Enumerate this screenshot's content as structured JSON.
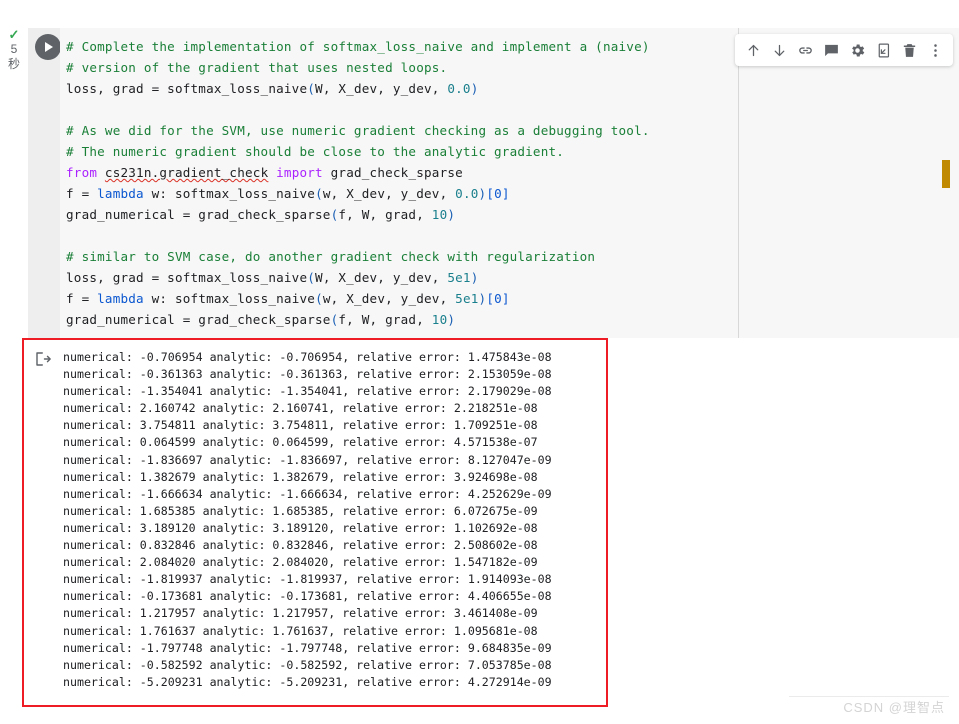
{
  "run_status": {
    "check_glyph": "✓",
    "seconds": "5",
    "unit": "秒",
    "check_color": "#34a853"
  },
  "cell": {
    "run_button_label": "run-cell",
    "toolbar": [
      {
        "name": "move-cell-up-icon",
        "label": "↑"
      },
      {
        "name": "move-cell-down-icon",
        "label": "↓"
      },
      {
        "name": "link-to-cell-icon",
        "label": "link"
      },
      {
        "name": "add-comment-icon",
        "label": "comment"
      },
      {
        "name": "cell-settings-icon",
        "label": "settings"
      },
      {
        "name": "mirror-cell-icon",
        "label": "mirror-cell"
      },
      {
        "name": "delete-cell-icon",
        "label": "delete"
      },
      {
        "name": "more-options-icon",
        "label": "⋮"
      }
    ]
  },
  "code": {
    "lines": [
      [
        {
          "t": "# Complete the implementation of softmax_loss_naive and implement a (naive)",
          "c": "tok-com"
        }
      ],
      [
        {
          "t": "# version of the gradient that uses nested loops.",
          "c": "tok-com"
        }
      ],
      [
        {
          "t": "loss, grad = softmax_loss_naive",
          "c": "tok-id"
        },
        {
          "t": "(",
          "c": "tok-par"
        },
        {
          "t": "W, X_dev, y_dev, ",
          "c": "tok-id"
        },
        {
          "t": "0.0",
          "c": "tok-num"
        },
        {
          "t": ")",
          "c": "tok-par"
        }
      ],
      [],
      [
        {
          "t": "# As we did for the SVM, use numeric gradient checking as a debugging tool.",
          "c": "tok-com"
        }
      ],
      [
        {
          "t": "# The numeric gradient should be close to the analytic gradient.",
          "c": "tok-com"
        }
      ],
      [
        {
          "t": "from ",
          "c": "tok-kw"
        },
        {
          "t": "cs231n.gradient_check",
          "c": "tok-id squiggle"
        },
        {
          "t": " import ",
          "c": "tok-kw"
        },
        {
          "t": "grad_check_sparse",
          "c": "tok-id"
        }
      ],
      [
        {
          "t": "f = ",
          "c": "tok-id"
        },
        {
          "t": "lambda",
          "c": "tok-bl"
        },
        {
          "t": " w: softmax_loss_naive",
          "c": "tok-id"
        },
        {
          "t": "(",
          "c": "tok-par"
        },
        {
          "t": "w, X_dev, y_dev, ",
          "c": "tok-id"
        },
        {
          "t": "0.0",
          "c": "tok-num"
        },
        {
          "t": ")",
          "c": "tok-par"
        },
        {
          "t": "[0]",
          "c": "tok-brk"
        }
      ],
      [
        {
          "t": "grad_numerical = grad_check_sparse",
          "c": "tok-id"
        },
        {
          "t": "(",
          "c": "tok-par"
        },
        {
          "t": "f, W, grad, ",
          "c": "tok-id"
        },
        {
          "t": "10",
          "c": "tok-num"
        },
        {
          "t": ")",
          "c": "tok-par"
        }
      ],
      [],
      [
        {
          "t": "# similar to SVM case, do another gradient check with regularization",
          "c": "tok-com"
        }
      ],
      [
        {
          "t": "loss, grad = softmax_loss_naive",
          "c": "tok-id"
        },
        {
          "t": "(",
          "c": "tok-par"
        },
        {
          "t": "W, X_dev, y_dev, ",
          "c": "tok-id"
        },
        {
          "t": "5e1",
          "c": "tok-num"
        },
        {
          "t": ")",
          "c": "tok-par"
        }
      ],
      [
        {
          "t": "f = ",
          "c": "tok-id"
        },
        {
          "t": "lambda",
          "c": "tok-bl"
        },
        {
          "t": " w: softmax_loss_naive",
          "c": "tok-id"
        },
        {
          "t": "(",
          "c": "tok-par"
        },
        {
          "t": "w, X_dev, y_dev, ",
          "c": "tok-id"
        },
        {
          "t": "5e1",
          "c": "tok-num"
        },
        {
          "t": ")",
          "c": "tok-par"
        },
        {
          "t": "[0]",
          "c": "tok-brk"
        }
      ],
      [
        {
          "t": "grad_numerical = grad_check_sparse",
          "c": "tok-id"
        },
        {
          "t": "(",
          "c": "tok-par"
        },
        {
          "t": "f, W, grad, ",
          "c": "tok-id"
        },
        {
          "t": "10",
          "c": "tok-num"
        },
        {
          "t": ")",
          "c": "tok-par"
        }
      ]
    ]
  },
  "output": {
    "icon_name": "output-stream-icon",
    "rows": [
      {
        "numerical": "-0.706954",
        "analytic": "-0.706954",
        "relative_error": "1.475843e-08"
      },
      {
        "numerical": "-0.361363",
        "analytic": "-0.361363",
        "relative_error": "2.153059e-08"
      },
      {
        "numerical": "-1.354041",
        "analytic": "-1.354041",
        "relative_error": "2.179029e-08"
      },
      {
        "numerical": "2.160742",
        "analytic": "2.160741",
        "relative_error": "2.218251e-08"
      },
      {
        "numerical": "3.754811",
        "analytic": "3.754811",
        "relative_error": "1.709251e-08"
      },
      {
        "numerical": "0.064599",
        "analytic": "0.064599",
        "relative_error": "4.571538e-07"
      },
      {
        "numerical": "-1.836697",
        "analytic": "-1.836697",
        "relative_error": "8.127047e-09"
      },
      {
        "numerical": "1.382679",
        "analytic": "1.382679",
        "relative_error": "3.924698e-08"
      },
      {
        "numerical": "-1.666634",
        "analytic": "-1.666634",
        "relative_error": "4.252629e-09"
      },
      {
        "numerical": "1.685385",
        "analytic": "1.685385",
        "relative_error": "6.072675e-09"
      },
      {
        "numerical": "3.189120",
        "analytic": "3.189120",
        "relative_error": "1.102692e-08"
      },
      {
        "numerical": "0.832846",
        "analytic": "0.832846",
        "relative_error": "2.508602e-08"
      },
      {
        "numerical": "2.084020",
        "analytic": "2.084020",
        "relative_error": "1.547182e-09"
      },
      {
        "numerical": "-1.819937",
        "analytic": "-1.819937",
        "relative_error": "1.914093e-08"
      },
      {
        "numerical": "-0.173681",
        "analytic": "-0.173681",
        "relative_error": "4.406655e-08"
      },
      {
        "numerical": "1.217957",
        "analytic": "1.217957",
        "relative_error": "3.461408e-09"
      },
      {
        "numerical": "1.761637",
        "analytic": "1.761637",
        "relative_error": "1.095681e-08"
      },
      {
        "numerical": "-1.797748",
        "analytic": "-1.797748",
        "relative_error": "9.684835e-09"
      },
      {
        "numerical": "-0.582592",
        "analytic": "-0.582592",
        "relative_error": "7.053785e-08"
      },
      {
        "numerical": "-5.209231",
        "analytic": "-5.209231",
        "relative_error": "4.272914e-09"
      }
    ],
    "label_numerical": "numerical:",
    "label_analytic": "analytic:",
    "label_relative_error": "relative error:"
  },
  "markers": {
    "orange_marker_color": "#c08a02",
    "highlight_box_color": "#ee1c24"
  },
  "watermark": {
    "text": "CSDN @理智点"
  }
}
